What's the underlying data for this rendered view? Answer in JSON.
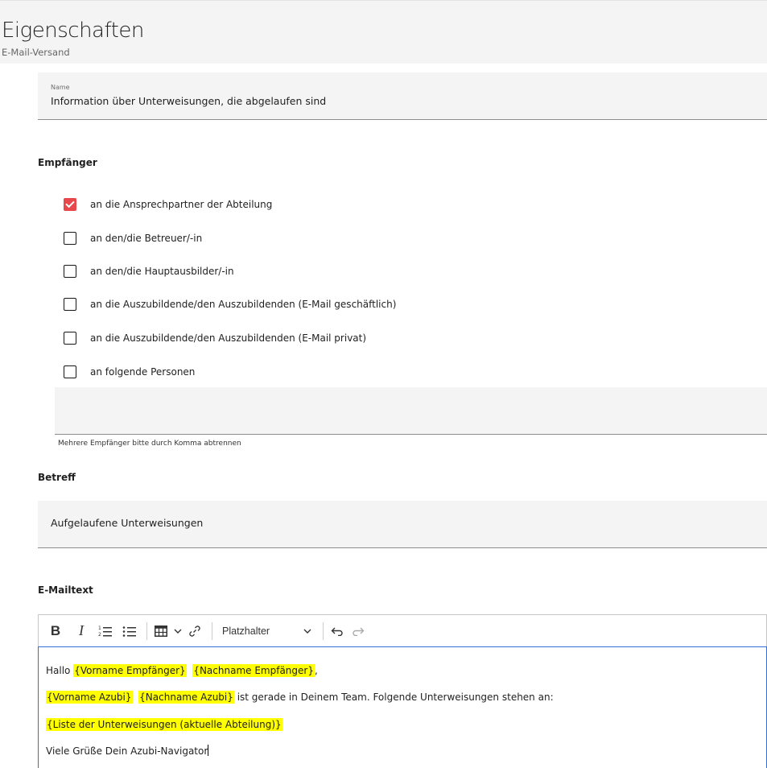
{
  "header": {
    "title": "Eigenschaften",
    "subtitle": "E-Mail-Versand"
  },
  "name_field": {
    "label": "Name",
    "value": "Information über Unterweisungen, die abgelaufen sind"
  },
  "recipients": {
    "heading": "Empfänger",
    "options": [
      {
        "label": "an die Ansprechpartner der Abteilung",
        "checked": true
      },
      {
        "label": "an den/die Betreuer/-in",
        "checked": false
      },
      {
        "label": "an den/die Hauptausbilder/-in",
        "checked": false
      },
      {
        "label": "an die Auszubildende/den Auszubildenden (E-Mail geschäftlich)",
        "checked": false
      },
      {
        "label": "an die Auszubildende/den Auszubildenden (E-Mail privat)",
        "checked": false
      },
      {
        "label": "an folgende Personen",
        "checked": false
      }
    ],
    "additional_value": "",
    "helper": "Mehrere Empfänger bitte durch Komma abtrennen"
  },
  "subject": {
    "heading": "Betreff",
    "value": "Aufgelaufene Unterweisungen"
  },
  "email_text": {
    "heading": "E-Mailtext",
    "toolbar": {
      "bold_glyph": "B",
      "italic_glyph": "I",
      "placeholder_dropdown": "Platzhalter",
      "icons": [
        "bold-icon",
        "italic-icon",
        "numbered-list-icon",
        "bullet-list-icon",
        "table-icon",
        "chevron-down-icon",
        "link-icon",
        "chevron-down-icon",
        "undo-icon",
        "redo-icon"
      ]
    },
    "lines": {
      "l1_prefix": "Hallo ",
      "l1_ph1": "{Vorname Empfänger}",
      "l1_ph2": "{Nachname Empfänger}",
      "l1_suffix": ",",
      "l2_ph1": "{Vorname Azubi}",
      "l2_ph2": "{Nachname Azubi}",
      "l2_suffix": " ist gerade in Deinem Team. Folgende Unterweisungen stehen an:",
      "l3_ph1": "{Liste der Unterweisungen (aktuelle Abteilung)}",
      "l4_text": "Viele Grüße Dein Azubi-Navigator"
    }
  },
  "colors": {
    "checkbox_checked": "#e8474b",
    "placeholder_highlight": "#ffff00",
    "editor_focus_border": "#2f6fd6",
    "field_background": "#f4f4f4"
  }
}
